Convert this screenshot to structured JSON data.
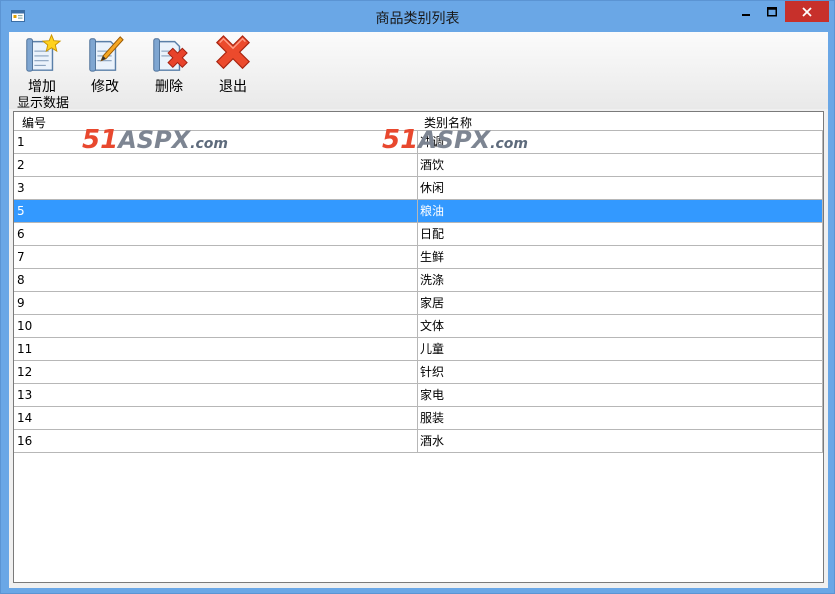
{
  "window": {
    "title": "商品类别列表"
  },
  "toolbar": {
    "add_label": "增加",
    "edit_label": "修改",
    "delete_label": "删除",
    "exit_label": "退出"
  },
  "status": {
    "text": "显示数据"
  },
  "grid": {
    "columns": [
      "编号",
      "类别名称"
    ],
    "rows": [
      {
        "id": "1",
        "name": "冲调"
      },
      {
        "id": "2",
        "name": "酒饮"
      },
      {
        "id": "3",
        "name": "休闲"
      },
      {
        "id": "5",
        "name": "粮油"
      },
      {
        "id": "6",
        "name": "日配"
      },
      {
        "id": "7",
        "name": "生鲜"
      },
      {
        "id": "8",
        "name": "洗涤"
      },
      {
        "id": "9",
        "name": "家居"
      },
      {
        "id": "10",
        "name": "文体"
      },
      {
        "id": "11",
        "name": "儿童"
      },
      {
        "id": "12",
        "name": "针织"
      },
      {
        "id": "13",
        "name": "家电"
      },
      {
        "id": "14",
        "name": "服装"
      },
      {
        "id": "16",
        "name": "酒水"
      }
    ],
    "selected_row": 3
  },
  "watermark": {
    "part1": "51",
    "part2": "ASPX",
    "part3": ".com"
  },
  "colors": {
    "titlebar": "#6aa7e6",
    "close_button": "#c7302b",
    "selection": "#3399ff"
  },
  "icons": {
    "add": "document-star-icon",
    "edit": "document-pencil-icon",
    "delete": "document-x-icon",
    "exit": "red-x-icon"
  }
}
